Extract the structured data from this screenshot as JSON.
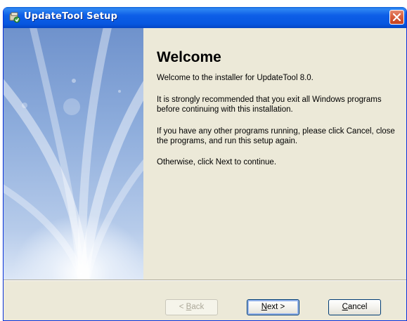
{
  "window": {
    "title": "UpdateTool Setup"
  },
  "page": {
    "heading": "Welcome",
    "paragraphs": [
      "Welcome to the installer for UpdateTool 8.0.",
      "It is strongly recommended that you exit all Windows programs before continuing with this installation.",
      "If you have any other programs running, please click Cancel, close the programs, and run this setup again.",
      "Otherwise, click Next to continue."
    ]
  },
  "buttons": {
    "back": {
      "mnemonic": "B",
      "rest": "ack",
      "prefix": "< ",
      "enabled": false
    },
    "next": {
      "mnemonic": "N",
      "rest": "ext >",
      "enabled": true
    },
    "cancel": {
      "mnemonic": "C",
      "rest": "ancel",
      "enabled": true
    }
  },
  "icons": {
    "title_icon": "setup-installer-icon",
    "close_icon": "close-x-icon"
  },
  "colors": {
    "titlebar": "#0757e0",
    "close_button": "#d85f3e",
    "dialog_background": "#ece9d8",
    "side_panel": "#8eaddc"
  }
}
